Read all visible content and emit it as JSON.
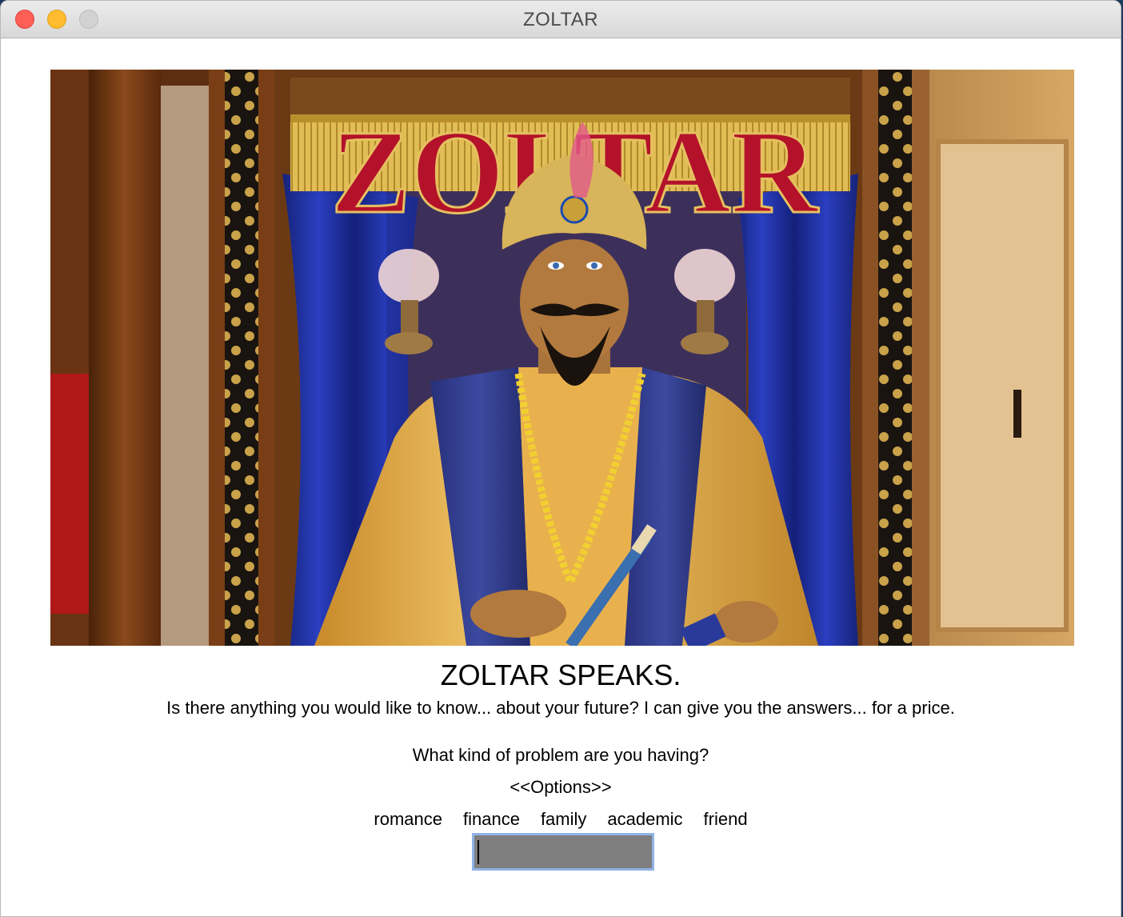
{
  "window": {
    "title": "ZOLTAR"
  },
  "image": {
    "sign_text": "ZOLTAR"
  },
  "main": {
    "heading": "ZOLTAR SPEAKS.",
    "intro": "Is there anything you would like to know... about your future? I can give you the answers... for a price.",
    "question": "What kind of problem are you having?",
    "options_label": "<<Options>>",
    "options": [
      "romance",
      "finance",
      "family",
      "academic",
      "friend"
    ],
    "input_value": ""
  },
  "colors": {
    "input_background": "#7f7f7f",
    "input_focus_ring": "#8fb3e6",
    "sign_red": "#b3122a",
    "curtain_blue": "#1e2f9e",
    "costume_gold": "#e8b24a"
  }
}
